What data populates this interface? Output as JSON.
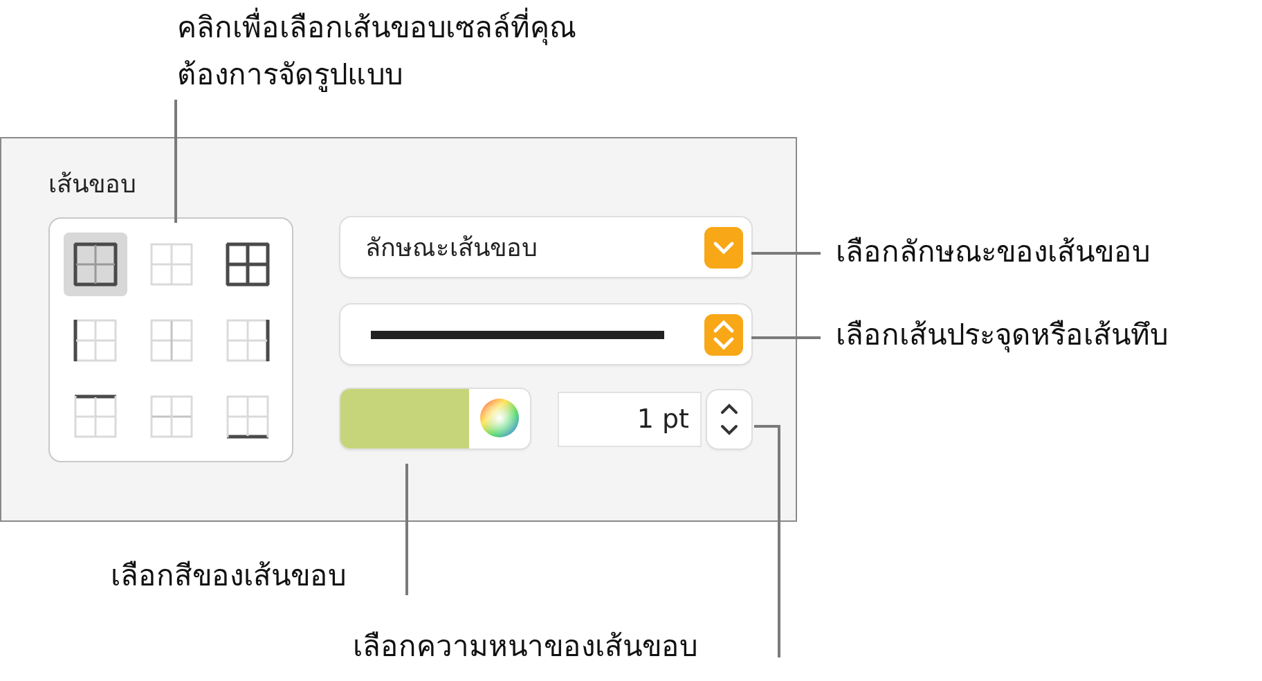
{
  "panel": {
    "title": "เส้นขอบ",
    "border_buttons": [
      {
        "kind": "outer",
        "selected": true
      },
      {
        "kind": "none",
        "selected": false
      },
      {
        "kind": "all",
        "selected": false
      },
      {
        "kind": "left",
        "selected": false
      },
      {
        "kind": "inner-vertical",
        "selected": false
      },
      {
        "kind": "right",
        "selected": false
      },
      {
        "kind": "top",
        "selected": false
      },
      {
        "kind": "inner-horizontal",
        "selected": false
      },
      {
        "kind": "bottom",
        "selected": false
      }
    ],
    "style_popup": {
      "label": "ลักษณะเส้นขอบ"
    },
    "line_popup": {
      "kind": "solid"
    },
    "color_well": {
      "color": "#c6d57a"
    },
    "width_field": {
      "value": "1 pt"
    }
  },
  "callouts": [
    {
      "kind": "grid",
      "text": "คลิกเพื่อเลือกเส้นขอบเซลล์ที่คุณต้องการจัดรูปแบบ"
    },
    {
      "kind": "style",
      "text": "เลือกลักษณะของเส้นขอบ"
    },
    {
      "kind": "line",
      "text": "เลือกเส้นประจุดหรือเส้นทึบ"
    },
    {
      "kind": "color",
      "text": "เลือกสีของเส้นขอบ"
    },
    {
      "kind": "width",
      "text": "เลือกความหนาของเส้นขอบ"
    }
  ]
}
